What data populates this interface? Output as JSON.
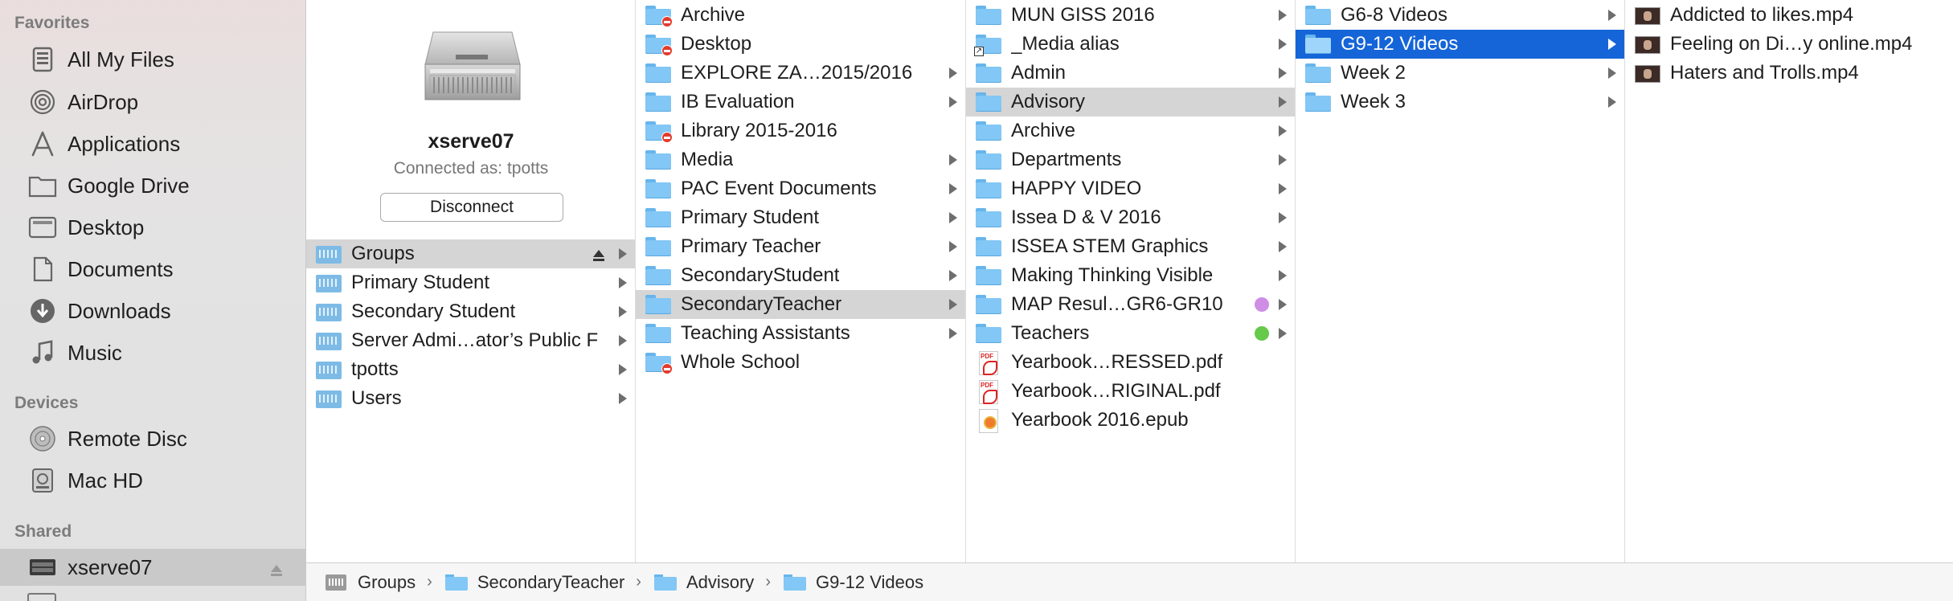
{
  "sidebar": {
    "favorites_header": "Favorites",
    "favorites": [
      {
        "label": "All My Files",
        "icon": "all-files-icon"
      },
      {
        "label": "AirDrop",
        "icon": "airdrop-icon"
      },
      {
        "label": "Applications",
        "icon": "applications-icon"
      },
      {
        "label": "Google Drive",
        "icon": "folder-icon"
      },
      {
        "label": "Desktop",
        "icon": "desktop-icon"
      },
      {
        "label": "Documents",
        "icon": "documents-icon"
      },
      {
        "label": "Downloads",
        "icon": "downloads-icon"
      },
      {
        "label": "Music",
        "icon": "music-icon"
      }
    ],
    "devices_header": "Devices",
    "devices": [
      {
        "label": "Remote Disc",
        "icon": "remote-disc-icon"
      },
      {
        "label": "Mac HD",
        "icon": "harddisk-icon"
      }
    ],
    "shared_header": "Shared",
    "shared": [
      {
        "label": "xserve07",
        "icon": "server-icon",
        "selected": true
      }
    ]
  },
  "preview": {
    "server_name": "xserve07",
    "connected_as": "Connected as: tpotts",
    "disconnect_label": "Disconnect"
  },
  "columns": {
    "col1": [
      {
        "label": "Groups",
        "eject": true
      },
      {
        "label": "Primary Student"
      },
      {
        "label": "Secondary Student"
      },
      {
        "label": "Server Admi…ator’s Public F"
      },
      {
        "label": "tpotts"
      },
      {
        "label": "Users"
      }
    ],
    "col2": [
      {
        "label": "Archive",
        "restricted": true
      },
      {
        "label": "Desktop",
        "restricted": true
      },
      {
        "label": "EXPLORE ZA…2015/2016"
      },
      {
        "label": "IB Evaluation"
      },
      {
        "label": "Library 2015-2016",
        "restricted": true
      },
      {
        "label": "Media"
      },
      {
        "label": "PAC Event Documents"
      },
      {
        "label": "Primary Student"
      },
      {
        "label": "Primary Teacher"
      },
      {
        "label": "SecondaryStudent"
      },
      {
        "label": "SecondaryTeacher"
      },
      {
        "label": "Teaching Assistants"
      },
      {
        "label": "Whole School",
        "restricted": true
      }
    ],
    "col3": [
      {
        "label": " MUN GISS 2016"
      },
      {
        "label": "_Media alias"
      },
      {
        "label": "Admin"
      },
      {
        "label": "Advisory"
      },
      {
        "label": "Archive"
      },
      {
        "label": "Departments"
      },
      {
        "label": "HAPPY VIDEO"
      },
      {
        "label": "Issea D & V  2016"
      },
      {
        "label": "ISSEA STEM Graphics"
      },
      {
        "label": "Making Thinking Visible"
      },
      {
        "label": "MAP Resul…GR6-GR10",
        "tag": "#cf8ee6"
      },
      {
        "label": "Teachers",
        "tag": "#66c94a"
      },
      {
        "label": "Yearbook…RESSED.pdf"
      },
      {
        "label": "Yearbook…RIGINAL.pdf"
      },
      {
        "label": "Yearbook 2016.epub"
      }
    ],
    "col4": [
      {
        "label": "G6-8 Videos"
      },
      {
        "label": "G9-12 Videos"
      },
      {
        "label": "Week 2"
      },
      {
        "label": "Week 3"
      }
    ],
    "col5": [
      {
        "label": "Addicted to likes.mp4"
      },
      {
        "label": "Feeling on Di…y online.mp4"
      },
      {
        "label": "Haters and Trolls.mp4"
      }
    ]
  },
  "pathbar": {
    "segments": [
      "Groups",
      "SecondaryTeacher",
      "Advisory",
      "G9-12 Videos"
    ]
  },
  "colors": {
    "selection_blue": "#1565d8",
    "selection_gray": "#d5d5d5",
    "folder_blue": "#82c7f5"
  }
}
